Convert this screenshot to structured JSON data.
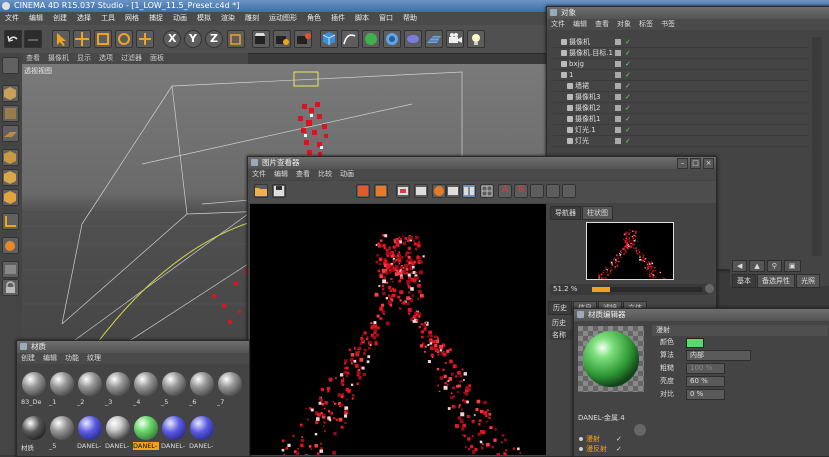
{
  "app": {
    "title": "CINEMA 4D R15.037 Studio - [1_LOW_11.5_Preset.c4d *]"
  },
  "menubar": [
    "文件",
    "编辑",
    "创建",
    "选择",
    "工具",
    "网格",
    "捕捉",
    "动画",
    "模拟",
    "渲染",
    "雕刻",
    "运动图形",
    "角色",
    "插件",
    "脚本",
    "窗口",
    "帮助"
  ],
  "toolbar": {
    "axes": [
      "X",
      "Y",
      "Z"
    ]
  },
  "viewport": {
    "menu": [
      "查看",
      "摄像机",
      "显示",
      "选项",
      "过滤器",
      "面板"
    ],
    "label": "透视视图"
  },
  "objects": {
    "title": "对象",
    "menu": [
      "文件",
      "编辑",
      "查看",
      "对象",
      "标签",
      "书签"
    ],
    "items": [
      {
        "name": "摄像机",
        "indent": 0
      },
      {
        "name": "摄像机.目标.1",
        "indent": 0
      },
      {
        "name": "bxjg",
        "indent": 0
      },
      {
        "name": "1",
        "indent": 0
      },
      {
        "name": "墙裙",
        "indent": 1
      },
      {
        "name": "摄像机3",
        "indent": 1
      },
      {
        "name": "摄像机2",
        "indent": 1
      },
      {
        "name": "摄像机1",
        "indent": 1
      },
      {
        "name": "灯光.1",
        "indent": 1
      },
      {
        "name": "灯光",
        "indent": 1
      }
    ],
    "tabs": [
      "基本",
      "坐标",
      "对象",
      "曲线",
      "平滑着色(Phong)",
      "显示",
      "备选系统"
    ],
    "tabs2": [
      "基本",
      "备选异性",
      "光照"
    ]
  },
  "picture_viewer": {
    "title": "图片查看器",
    "menu": [
      "文件",
      "编辑",
      "查看",
      "比较",
      "动画"
    ],
    "nav_tabs": [
      "导航器",
      "柱状图"
    ],
    "zoom": "51.2 %",
    "history_tabs": [
      "历史",
      "信息",
      "滤镜",
      "立体"
    ],
    "history_label": "历史",
    "name_label": "名称"
  },
  "materials": {
    "title": "材质",
    "menu": [
      "创建",
      "编辑",
      "功能",
      "纹理"
    ],
    "row1": [
      "83_De",
      "_1",
      "_2",
      "_3",
      "_4",
      "_5",
      "_6",
      "_7"
    ],
    "row2": [
      "材质",
      "_5",
      "DANEL-",
      "DANEL-",
      "DANEL-",
      "DANEL-",
      "DANEL-",
      ""
    ]
  },
  "material_editor": {
    "title": "材质编辑器",
    "section": "漫射",
    "material_name": "DANEL-金属.4",
    "props": [
      {
        "label": "颜色",
        "value": ""
      },
      {
        "label": "算法",
        "value": "内部"
      },
      {
        "label": "粗糙",
        "value": "100 %"
      },
      {
        "label": "亮度",
        "value": "60 %"
      },
      {
        "label": "对比",
        "value": "0 %"
      }
    ],
    "channels": [
      "漫射",
      "漫反射"
    ],
    "colors": {
      "diffuse": "#5bd96b"
    }
  },
  "colors": {
    "accent": "#f6a21b",
    "titlebar": "#4f7fb8"
  }
}
